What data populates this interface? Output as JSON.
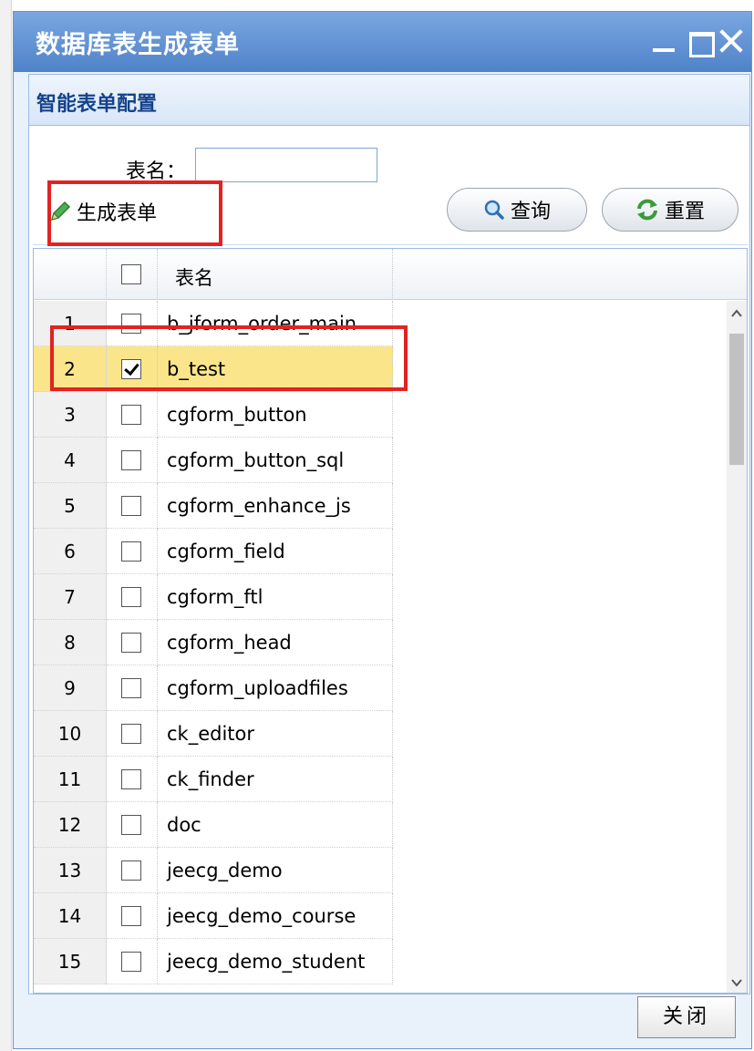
{
  "window": {
    "title": "数据库表生成表单"
  },
  "panel": {
    "title": "智能表单配置"
  },
  "search": {
    "label": "表名：",
    "value": ""
  },
  "toolbar": {
    "generate_label": "生成表单",
    "query_label": "查询",
    "reset_label": "重置"
  },
  "grid": {
    "column_header": "表名",
    "rows": [
      {
        "num": "1",
        "name": "b_jform_order_main",
        "checked": false
      },
      {
        "num": "2",
        "name": "b_test",
        "checked": true
      },
      {
        "num": "3",
        "name": "cgform_button",
        "checked": false
      },
      {
        "num": "4",
        "name": "cgform_button_sql",
        "checked": false
      },
      {
        "num": "5",
        "name": "cgform_enhance_js",
        "checked": false
      },
      {
        "num": "6",
        "name": "cgform_field",
        "checked": false
      },
      {
        "num": "7",
        "name": "cgform_ftl",
        "checked": false
      },
      {
        "num": "8",
        "name": "cgform_head",
        "checked": false
      },
      {
        "num": "9",
        "name": "cgform_uploadfiles",
        "checked": false
      },
      {
        "num": "10",
        "name": "ck_editor",
        "checked": false
      },
      {
        "num": "11",
        "name": "ck_finder",
        "checked": false
      },
      {
        "num": "12",
        "name": "doc",
        "checked": false
      },
      {
        "num": "13",
        "name": "jeecg_demo",
        "checked": false
      },
      {
        "num": "14",
        "name": "jeecg_demo_course",
        "checked": false
      },
      {
        "num": "15",
        "name": "jeecg_demo_student",
        "checked": false
      }
    ]
  },
  "footer": {
    "close_label": "关闭"
  },
  "colors": {
    "titlebar": "#5a8fd6",
    "highlight": "#fbe58b",
    "annotation": "#e32222"
  }
}
